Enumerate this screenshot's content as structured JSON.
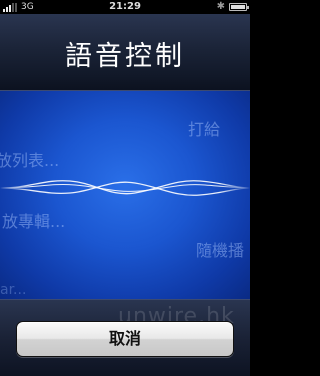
{
  "status_bar": {
    "network": "3G",
    "time": "21:29"
  },
  "title": "語音控制",
  "suggestions": [
    "打給",
    "放列表...",
    "放專輯...",
    "隨機播",
    "ar..."
  ],
  "watermark": "unwire.hk",
  "cancel_label": "取消",
  "colors": {
    "voice_bg": "#1b56d0",
    "title_bg": "#1b2438",
    "wave": "#ffffff"
  }
}
